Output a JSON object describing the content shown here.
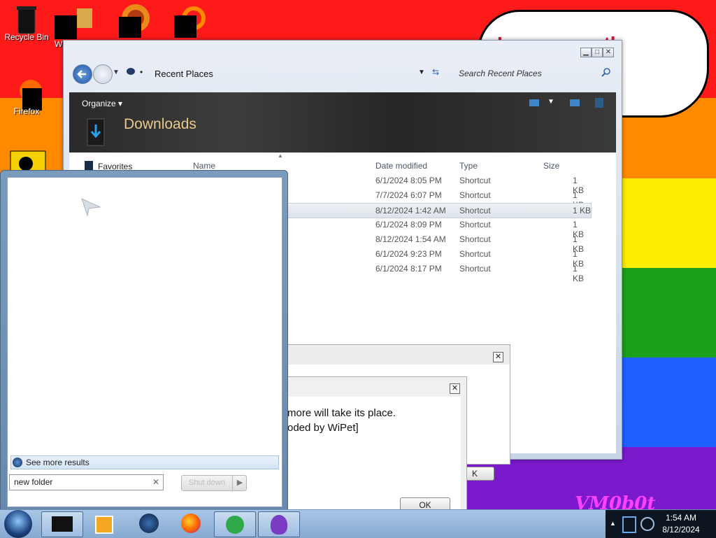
{
  "wallpaper": {
    "stripe_colors": [
      "#ff1a1a",
      "#ff8a00",
      "#ffee00",
      "#1aa01a",
      "#1e5fff",
      "#7a1acc"
    ],
    "bubble_text": "I... ... ...month",
    "watermark": "VM0b0t"
  },
  "desktop": {
    "icons": [
      {
        "label": "Recycle Bin",
        "icon": "recycle-bin-icon"
      },
      {
        "label": "W",
        "icon": "word-icon"
      },
      {
        "label": "Firefox",
        "icon": "firefox-icon"
      }
    ]
  },
  "explorer": {
    "address": "Recent Places",
    "search_placeholder": "Search Recent Places",
    "organize_label": "Organize",
    "folder_title": "Downloads",
    "sidebar_favorites": "Favorites",
    "columns": {
      "name": "Name",
      "date": "Date modified",
      "type": "Type",
      "size": "Size"
    },
    "rows": [
      {
        "date": "6/1/2024 8:05 PM",
        "type": "Shortcut",
        "size": "1 KB"
      },
      {
        "date": "7/7/2024 6:07 PM",
        "type": "Shortcut",
        "size": "1 KB"
      },
      {
        "date": "8/12/2024 1:42 AM",
        "type": "Shortcut",
        "size": "1 KB"
      },
      {
        "date": "6/1/2024 8:09 PM",
        "type": "Shortcut",
        "size": "1 KB"
      },
      {
        "date": "8/12/2024 1:54 AM",
        "type": "Shortcut",
        "size": "1 KB"
      },
      {
        "date": "6/1/2024 9:23 PM",
        "type": "Shortcut",
        "size": "1 KB"
      },
      {
        "date": "6/1/2024 8:17 PM",
        "type": "Shortcut",
        "size": "1 KB"
      }
    ]
  },
  "dialog_back": {
    "ok_label": "K"
  },
  "dialog_front": {
    "line1": "more will take its place.",
    "line2": "oded by WiPet]",
    "ok_label": "OK"
  },
  "start_menu": {
    "see_more": "See more results",
    "search_value": "new folder",
    "shutdown_label": "Shut down"
  },
  "clock": {
    "time": "1:54 AM",
    "date": "8/12/2024"
  }
}
